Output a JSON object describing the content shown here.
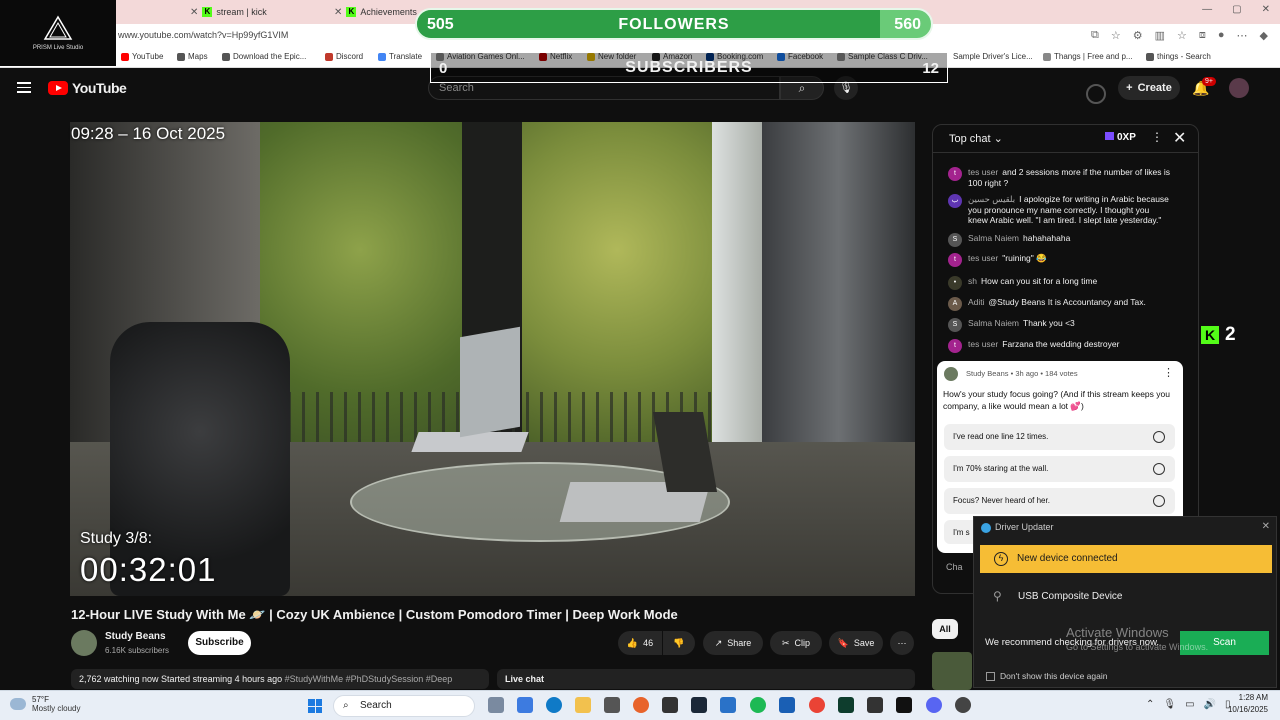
{
  "browser": {
    "tabs": [
      {
        "label": "stream | kick"
      },
      {
        "label": "Achievements"
      }
    ],
    "url": "www.youtube.com/watch?v=Hp99yfG1VIM",
    "bookmarks": [
      "YouTube",
      "Maps",
      "Download the Epic...",
      "Discord",
      "Translate",
      "Aviation Games Onl...",
      "Netflix",
      "New folder",
      "Amazon",
      "Booking.com",
      "Facebook",
      "Sample Class C Driv...",
      "Sample Driver's Lice...",
      "Thangs | Free and p...",
      "things - Search"
    ]
  },
  "prism": {
    "label": "PRISM Live Studio"
  },
  "overlay": {
    "followers": {
      "current": "505",
      "goal": "560",
      "label": "FOLLOWERS",
      "progress_fraction": 0.9
    },
    "subscribers": {
      "current": "0",
      "goal": "12",
      "label": "SUBSCRIBERS"
    },
    "kick": {
      "logo": "K",
      "count": "2"
    }
  },
  "youtube": {
    "logo_text": "YouTube",
    "search_placeholder": "Search",
    "create_label": "Create",
    "notification_badge": "9+"
  },
  "video": {
    "datetime": "09:28 – 16 Oct 2025",
    "study_label": "Study 3/8:",
    "study_timer": "00:32:01",
    "title": "12-Hour LIVE Study With Me 🪐 | Cozy UK Ambience | Custom Pomodoro Timer | Deep Work Mode",
    "channel_name": "Study Beans",
    "channel_subs": "6.16K subscribers",
    "subscribe_label": "Subscribe",
    "likes": "46",
    "share_label": "Share",
    "clip_label": "Clip",
    "save_label": "Save",
    "more_label": "⋯",
    "description_stats": "2,762 watching now  Started streaming 4 hours ago",
    "description_tags": "#StudyWithMe #PhDStudySession #Deep",
    "live_chat_label": "Live chat"
  },
  "chat": {
    "header": "Top chat",
    "xp": "0XP",
    "messages": [
      {
        "author": "tes user",
        "text": "and 2 sessions more if the number of likes is 100 right ?",
        "avatar": "t",
        "color": "#a3238e"
      },
      {
        "author": "بلقيس حسين",
        "text": "I apologize for writing in Arabic because you pronounce my name correctly. I thought you knew Arabic well. \"I am tired. I slept late yesterday.\"",
        "avatar": "ب",
        "color": "#5e35b1"
      },
      {
        "author": "Salma Naiem",
        "text": "hahahahaha",
        "avatar": "S",
        "color": "#555555"
      },
      {
        "author": "tes user",
        "text": "\"ruining\" 😂",
        "avatar": "t",
        "color": "#a3238e"
      },
      {
        "author": "sh",
        "text": "How can you sit for a long time",
        "avatar": "•",
        "color": "#3a3a2a"
      },
      {
        "author": "Aditi",
        "text": "@Study Beans It is Accountancy and Tax.",
        "avatar": "A",
        "color": "#6b5a4a"
      },
      {
        "author": "Salma Naiem",
        "text": "Thank you <3",
        "avatar": "S",
        "color": "#555555"
      },
      {
        "author": "tes user",
        "text": "Farzana the wedding destroyer",
        "avatar": "t",
        "color": "#a3238e"
      }
    ],
    "input_placeholder": "Cha"
  },
  "poll": {
    "meta": "Study Beans • 3h ago • 184 votes",
    "question": "How's your study focus going? (And if this stream keeps you company, a like would mean a lot 💕)",
    "options": [
      "I've read one line 12 times.",
      "I'm 70% staring at the wall.",
      "Focus? Never heard of her.",
      "I'm s"
    ]
  },
  "related": {
    "all_chip": "All"
  },
  "driver_updater": {
    "title": "Driver Updater",
    "alert": "New device connected",
    "device": "USB Composite Device",
    "recommend": "We recommend checking for drivers now.",
    "scan_label": "Scan",
    "dont_show": "Don't show this device again"
  },
  "windows": {
    "activate_title": "Activate Windows",
    "activate_sub": "Go to Settings to activate Windows."
  },
  "taskbar": {
    "temp": "57°F",
    "weather": "Mostly cloudy",
    "search_label": "Search",
    "time": "1:28 AM",
    "date": "10/16/2025"
  }
}
